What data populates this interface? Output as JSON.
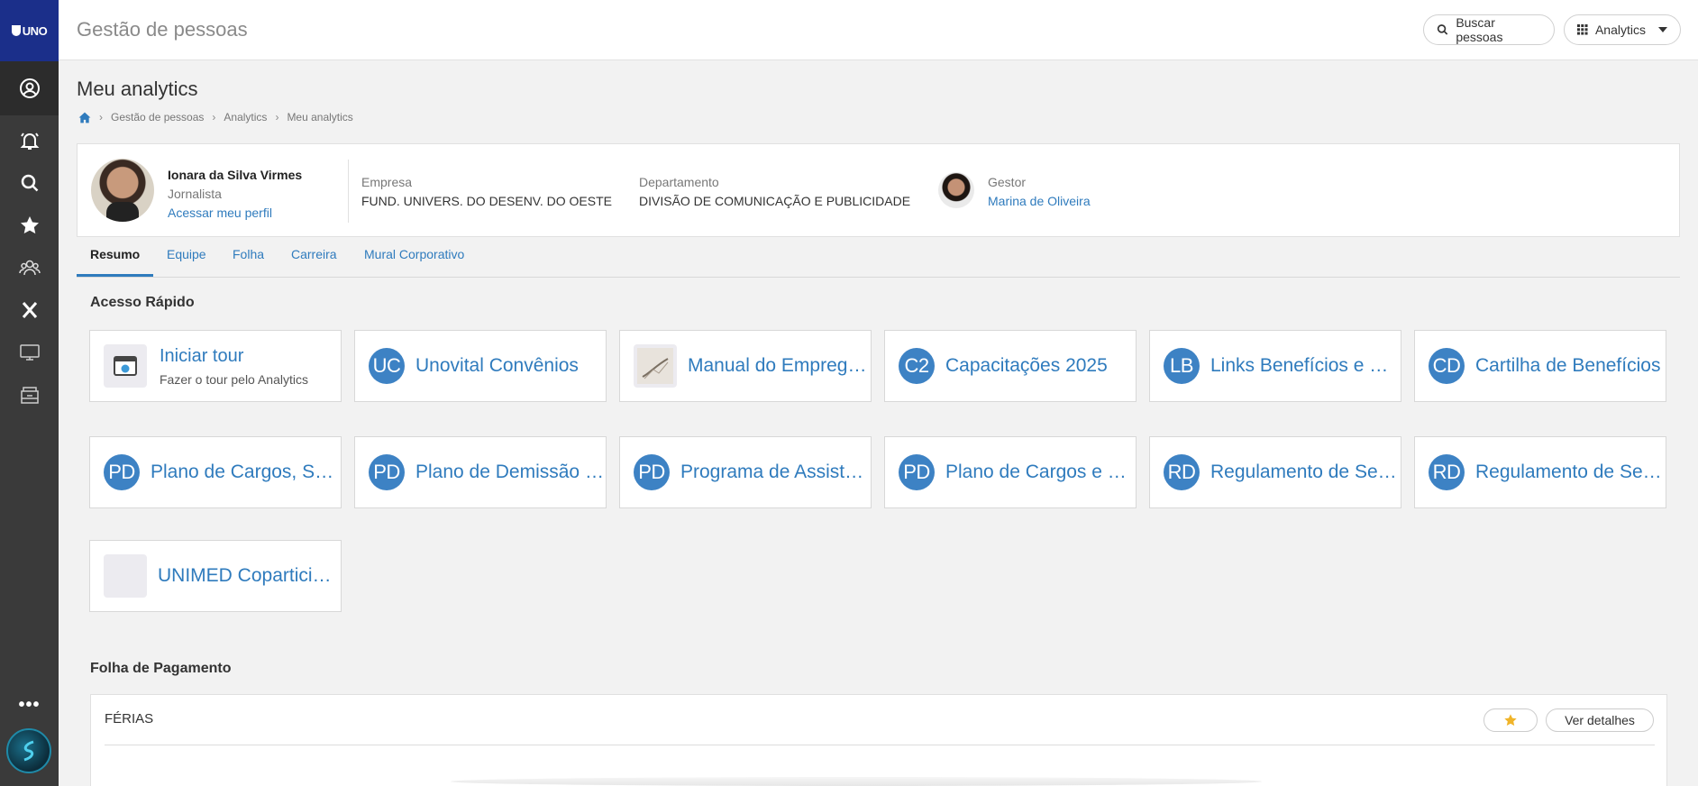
{
  "sidebar": {
    "logo_text": "UNO",
    "icons": [
      "profile-icon",
      "bell-icon",
      "search-icon",
      "star-icon",
      "team-icon",
      "close-icon",
      "monitor-icon",
      "box-icon"
    ],
    "more_label": "•••",
    "bg_color": "#3a3a3a",
    "logo_bg": "#1b2f8a"
  },
  "header": {
    "app_title": "Gestão de pessoas",
    "search_button": "Buscar pessoas",
    "apps_button": "Analytics"
  },
  "page": {
    "title": "Meu analytics",
    "breadcrumb": [
      "Gestão de pessoas",
      "Analytics",
      "Meu analytics"
    ]
  },
  "profile": {
    "name": "Ionara da Silva Virmes",
    "role": "Jornalista",
    "profile_link": "Acessar meu perfil",
    "company_label": "Empresa",
    "company_value": "FUND. UNIVERS. DO DESENV. DO OESTE",
    "department_label": "Departamento",
    "department_value": "DIVISÃO DE COMUNICAÇÃO E PUBLICIDADE",
    "manager_label": "Gestor",
    "manager_name": "Marina de Oliveira"
  },
  "tabs": [
    "Resumo",
    "Equipe",
    "Folha",
    "Carreira",
    "Mural Corporativo"
  ],
  "quick_access": {
    "title": "Acesso Rápido",
    "tour": {
      "title": "Iniciar tour",
      "subtitle": "Fazer o tour pelo Analytics"
    },
    "cards": [
      {
        "badge": "UC",
        "title": "Unovital Convênios"
      },
      {
        "badge": "",
        "title": "Manual do Empregado"
      },
      {
        "badge": "C2",
        "title": "Capacitações 2025"
      },
      {
        "badge": "LB",
        "title": "Links Benefícios e Serviços"
      },
      {
        "badge": "CD",
        "title": "Cartilha de Benefícios"
      },
      {
        "badge": "PD",
        "title": "Plano de Cargos, Salários"
      },
      {
        "badge": "PD",
        "title": "Plano de Demissão Voluntária"
      },
      {
        "badge": "PD",
        "title": "Programa de Assistência"
      },
      {
        "badge": "PD",
        "title": "Plano de Cargos e Salários"
      },
      {
        "badge": "RD",
        "title": "Regulamento de Serviços"
      },
      {
        "badge": "RD",
        "title": "Regulamento de Serviços"
      },
      {
        "badge": "",
        "title": "UNIMED Coparticipação"
      }
    ],
    "accent_color": "#3d82c4"
  },
  "payroll": {
    "title": "Folha de Pagamento",
    "section_label": "FÉRIAS",
    "details_button": "Ver detalhes"
  }
}
